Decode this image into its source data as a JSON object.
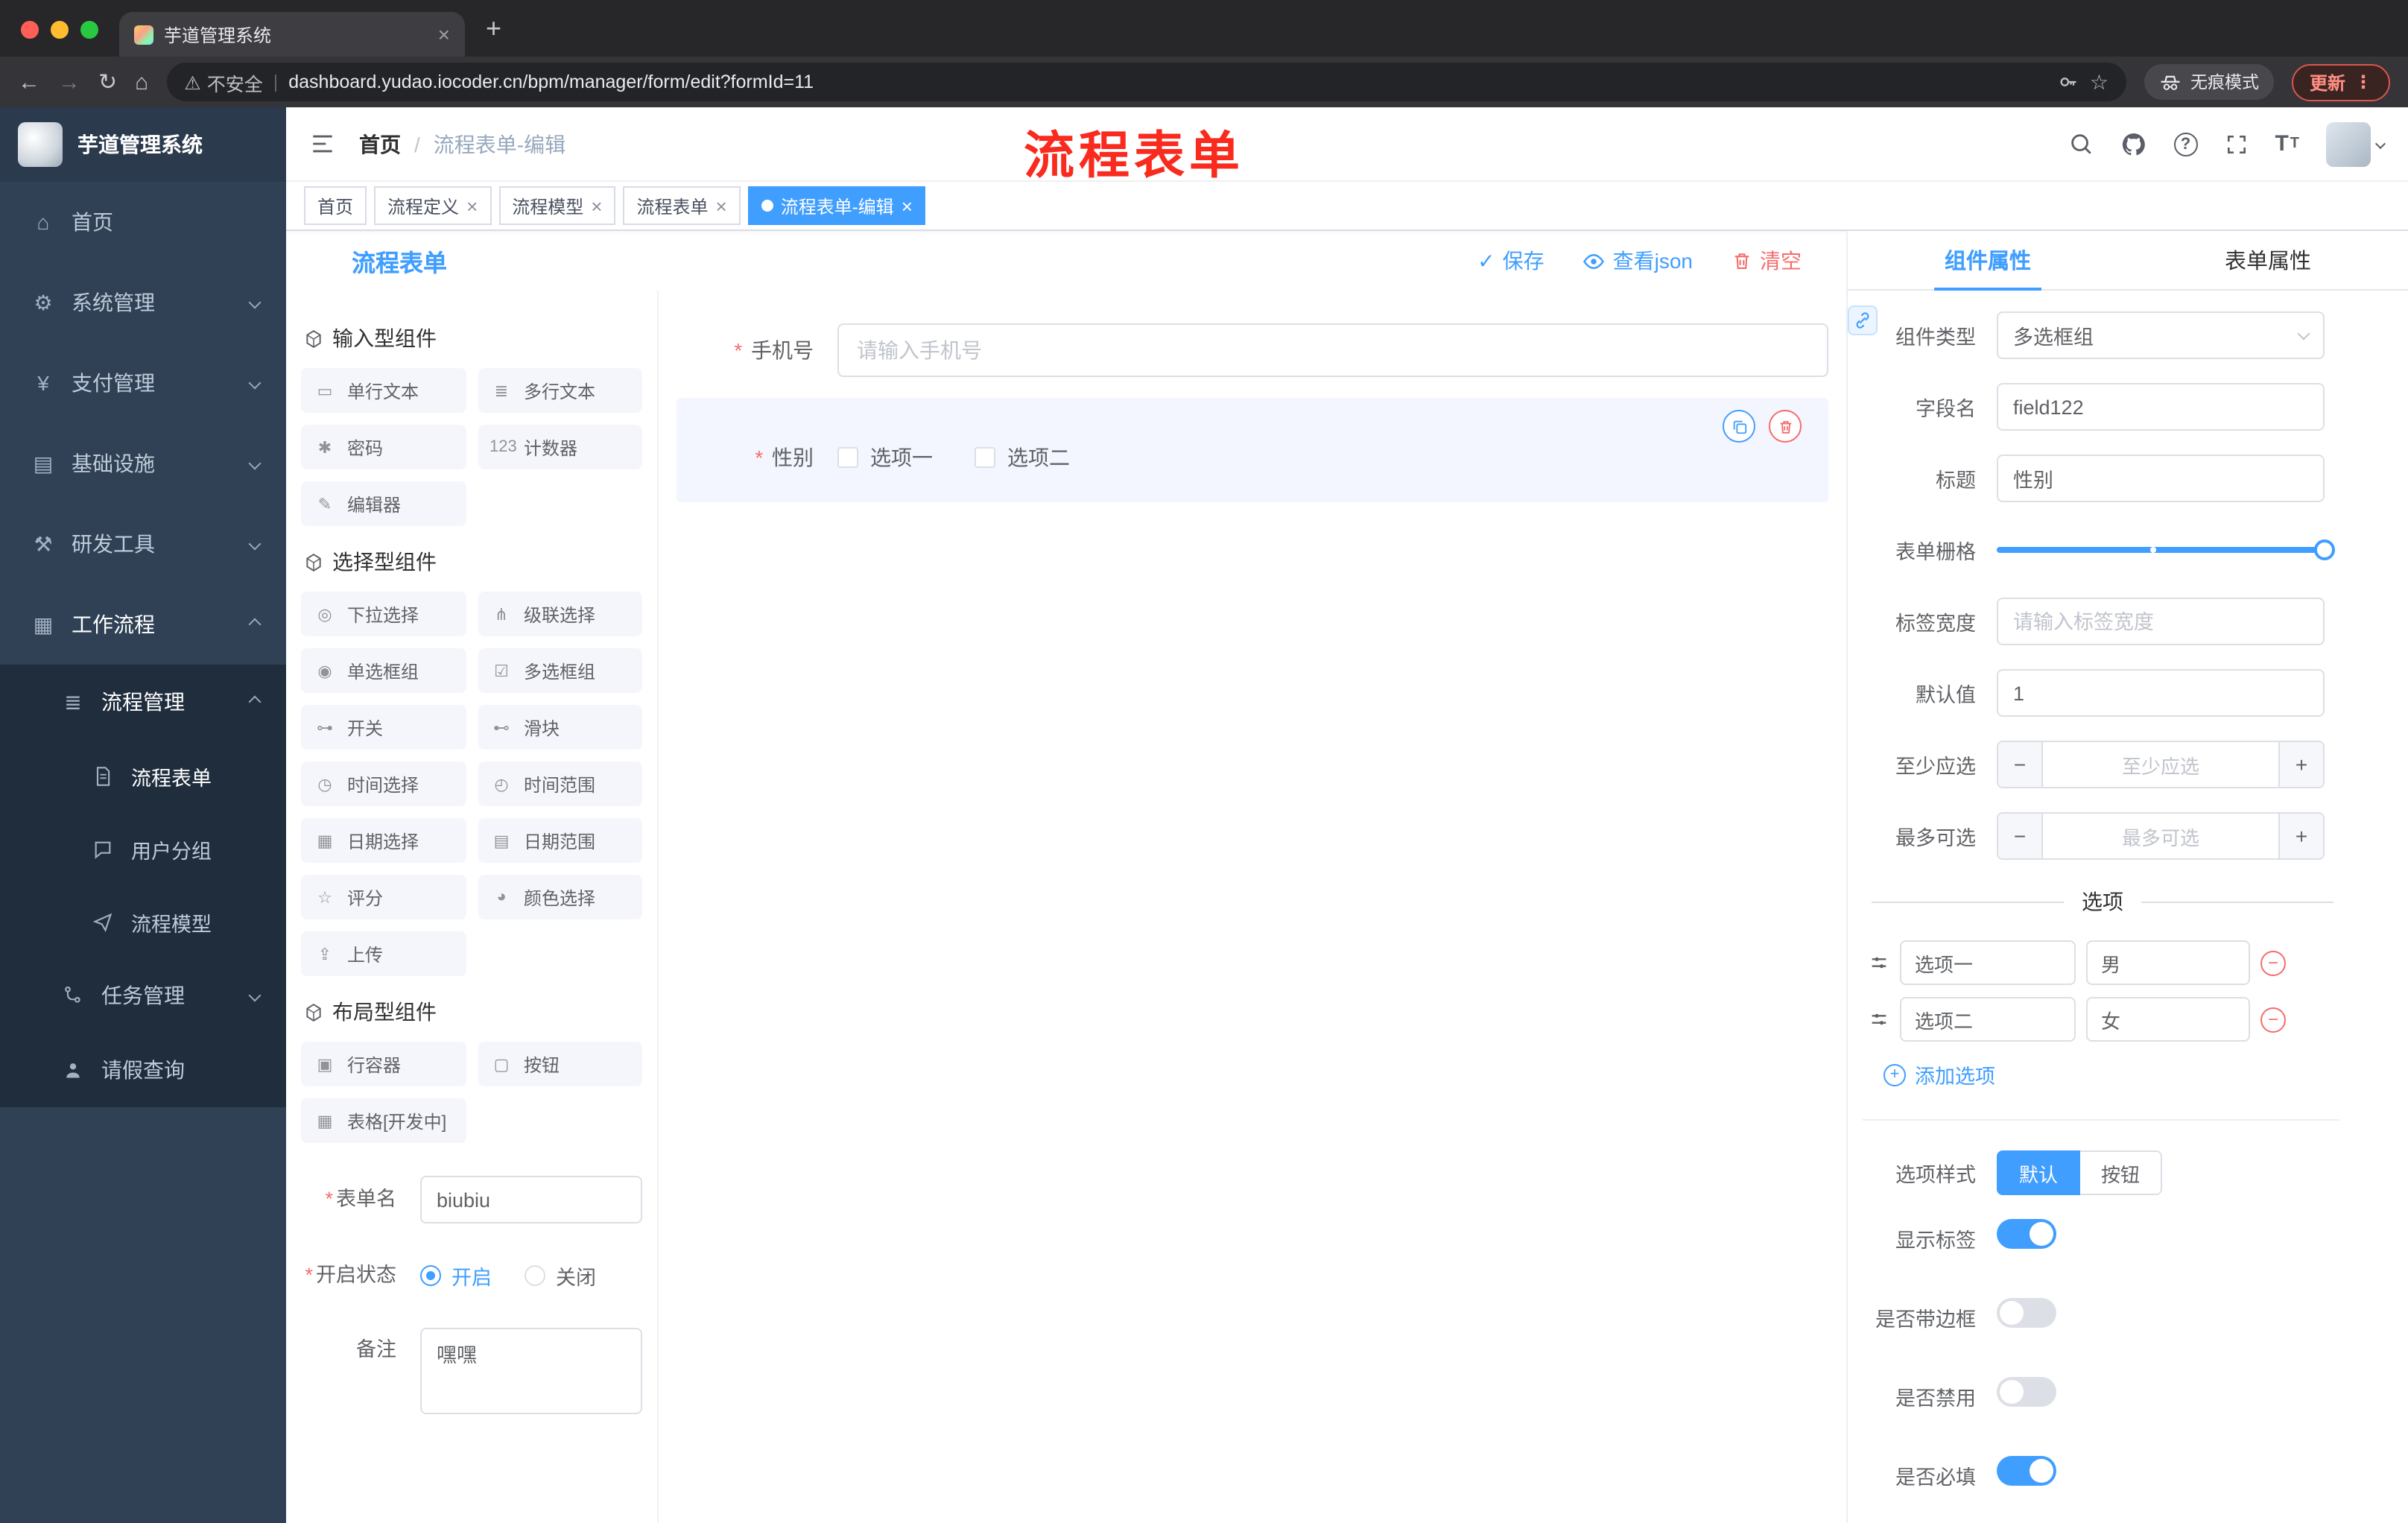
{
  "colors": {
    "primary": "#409eff",
    "danger": "#f56c6c",
    "sidebar_bg": "#304156",
    "sidebar_sub_bg": "#1f2d3d",
    "annotation_red": "#f92a1e",
    "tag_active": "#409eff"
  },
  "annotation": {
    "text": "流程表单"
  },
  "browser": {
    "tab_title": "芋道管理系统",
    "security_label": "不安全",
    "url": "dashboard.yudao.iocoder.cn/bpm/manager/form/edit?formId=11",
    "incognito_label": "无痕模式",
    "update_label": "更新"
  },
  "sidebar": {
    "logo_title": "芋道管理系统",
    "menu": [
      {
        "label": "首页"
      },
      {
        "label": "系统管理"
      },
      {
        "label": "支付管理"
      },
      {
        "label": "基础设施"
      },
      {
        "label": "研发工具"
      },
      {
        "label": "工作流程"
      }
    ],
    "process_group": {
      "label": "流程管理",
      "children": [
        {
          "label": "流程表单"
        },
        {
          "label": "用户分组"
        },
        {
          "label": "流程模型"
        }
      ]
    },
    "task_item": {
      "label": "任务管理"
    },
    "leave_item": {
      "label": "请假查询"
    }
  },
  "breadcrumb": {
    "home": "首页",
    "current": "流程表单-编辑"
  },
  "tags": [
    {
      "label": "首页"
    },
    {
      "label": "流程定义"
    },
    {
      "label": "流程模型"
    },
    {
      "label": "流程表单"
    },
    {
      "label": "流程表单-编辑"
    }
  ],
  "designer": {
    "panel_title": "流程表单",
    "save": "保存",
    "view_json": "查看json",
    "clear": "清空",
    "groups": [
      {
        "title": "输入型组件",
        "items": [
          {
            "label": "单行文本",
            "glyph": "▭"
          },
          {
            "label": "多行文本",
            "glyph": "≣"
          },
          {
            "label": "密码",
            "glyph": "✱"
          },
          {
            "label": "计数器",
            "glyph": "123"
          },
          {
            "label": "编辑器",
            "glyph": "✎"
          }
        ]
      },
      {
        "title": "选择型组件",
        "items": [
          {
            "label": "下拉选择",
            "glyph": "◎"
          },
          {
            "label": "级联选择",
            "glyph": "⋔"
          },
          {
            "label": "单选框组",
            "glyph": "◉"
          },
          {
            "label": "多选框组",
            "glyph": "☑"
          },
          {
            "label": "开关",
            "glyph": "⊶"
          },
          {
            "label": "滑块",
            "glyph": "⊷"
          },
          {
            "label": "时间选择",
            "glyph": "◷"
          },
          {
            "label": "时间范围",
            "glyph": "◴"
          },
          {
            "label": "日期选择",
            "glyph": "▦"
          },
          {
            "label": "日期范围",
            "glyph": "▤"
          },
          {
            "label": "评分",
            "glyph": "☆"
          },
          {
            "label": "颜色选择",
            "glyph": "◕"
          },
          {
            "label": "上传",
            "glyph": "⇪"
          }
        ]
      },
      {
        "title": "布局型组件",
        "items": [
          {
            "label": "行容器",
            "glyph": "▣"
          },
          {
            "label": "按钮",
            "glyph": "▢"
          },
          {
            "label": "表格[开发中]",
            "glyph": "▦"
          }
        ]
      }
    ],
    "meta": {
      "form_name_label": "表单名",
      "form_name_value": "biubiu",
      "status_label": "开启状态",
      "status_on": "开启",
      "status_off": "关闭",
      "remark_label": "备注",
      "remark_value": "嘿嘿"
    },
    "canvas": {
      "phone": {
        "label": "手机号",
        "placeholder": "请输入手机号"
      },
      "gender": {
        "label": "性别",
        "option1": "选项一",
        "option2": "选项二"
      }
    }
  },
  "props": {
    "tab_component": "组件属性",
    "tab_form": "表单属性",
    "component_type_label": "组件类型",
    "component_type_value": "多选框组",
    "field_name_label": "字段名",
    "field_name_value": "field122",
    "title_label": "标题",
    "title_value": "性别",
    "grid_label": "表单栅格",
    "label_width_label": "标签宽度",
    "label_width_placeholder": "请输入标签宽度",
    "default_label": "默认值",
    "default_value": "1",
    "min_label": "至少应选",
    "min_placeholder": "至少应选",
    "max_label": "最多可选",
    "max_placeholder": "最多可选",
    "options_title": "选项",
    "options": [
      {
        "label": "选项一",
        "value": "男"
      },
      {
        "label": "选项二",
        "value": "女"
      }
    ],
    "add_option": "添加选项",
    "style_label": "选项样式",
    "style_default": "默认",
    "style_button": "按钮",
    "show_label": "显示标签",
    "border_label": "是否带边框",
    "disabled_label": "是否禁用",
    "required_label": "是否必填"
  }
}
